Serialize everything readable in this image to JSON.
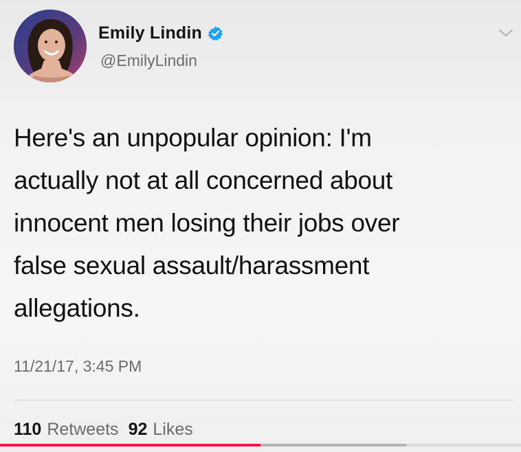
{
  "author": {
    "name": "Emily Lindin",
    "handle": "@EmilyLindin",
    "verified": true
  },
  "tweet": {
    "text": "Here's an unpopular opinion: I'm\nactually not at all concerned about\ninnocent men losing their jobs over\nfalse sexual assault/harassment\nallegations.",
    "timestamp": "11/21/17, 3:45 PM"
  },
  "stats": {
    "retweets_count": "110",
    "retweets_label": "Retweets",
    "likes_count": "92",
    "likes_label": "Likes"
  },
  "icons": {
    "verified": "verified-badge-icon",
    "menu": "chevron-down-icon"
  },
  "colors": {
    "verified_blue": "#1da1f2",
    "progress_red": "#ff1744",
    "secondary_text": "#6b6b6b"
  },
  "video_progress": {
    "played_fraction": 0.5
  }
}
